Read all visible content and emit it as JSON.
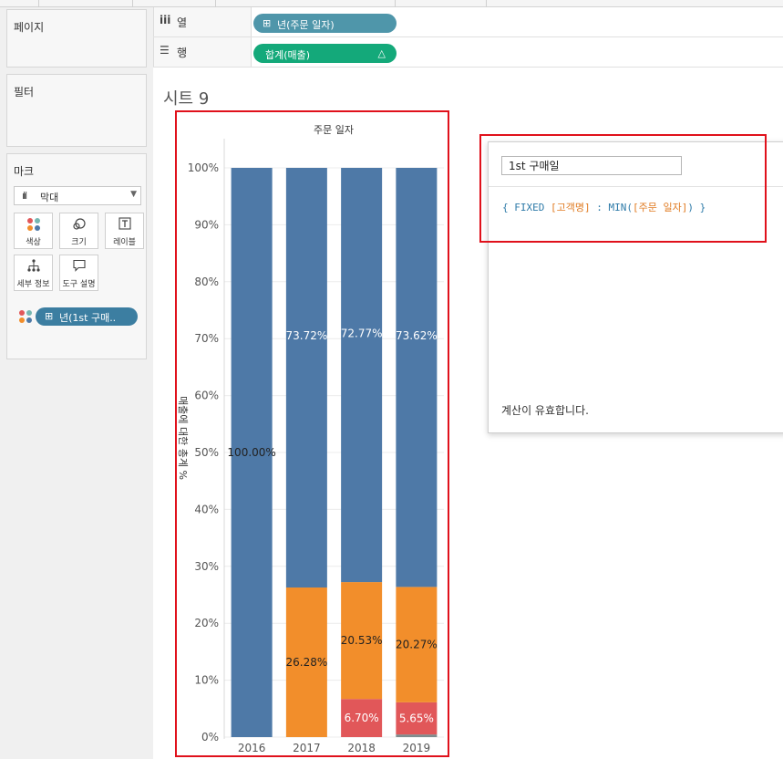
{
  "shelves": {
    "columns": {
      "label": "열",
      "icon": "iii",
      "pill_label": "년(주문 일자)",
      "pill_icon": "⊞",
      "pill_color": "#4f96aa"
    },
    "rows": {
      "label": "행",
      "icon": "☰",
      "pill_label": "합계(매출)",
      "pill_delta": "△",
      "pill_color": "#14a97a"
    }
  },
  "cards": {
    "pages": {
      "title": "페이지"
    },
    "filters": {
      "title": "필터"
    },
    "marks": {
      "title": "마크",
      "mark_type": "막대",
      "buttons": {
        "color": "색상",
        "size": "크기",
        "label": "레이블",
        "detail": "세부 정보",
        "tooltip": "도구 설명"
      },
      "color_pill": "년(1st 구매..",
      "color_pill_icon": "⊞"
    }
  },
  "sheet": {
    "title": "시트 9"
  },
  "chart_data": {
    "type": "bar",
    "stacked": true,
    "header": "주문 일자",
    "categories": [
      "2016",
      "2017",
      "2018",
      "2019"
    ],
    "ylabel": "매출에 대한 총계 %",
    "ylim": [
      0,
      100
    ],
    "yticks": [
      "0%",
      "10%",
      "20%",
      "30%",
      "40%",
      "50%",
      "60%",
      "70%",
      "80%",
      "90%",
      "100%"
    ],
    "series": [
      {
        "color": "#7f8c8d",
        "values": [
          0,
          0,
          0,
          0.46
        ],
        "labels": [
          "",
          "",
          "",
          ""
        ]
      },
      {
        "color": "#e15759",
        "values": [
          0,
          0,
          6.7,
          5.65
        ],
        "labels": [
          "",
          "",
          "6.70%",
          "5.65%"
        ]
      },
      {
        "color": "#f28e2b",
        "values": [
          0,
          26.28,
          20.53,
          20.27
        ],
        "labels": [
          "",
          "26.28%",
          "20.53%",
          "20.27%"
        ]
      },
      {
        "color": "#4e79a7",
        "values": [
          100.0,
          73.72,
          72.77,
          73.62
        ],
        "labels": [
          "100.00%",
          "73.72%",
          "72.77%",
          "73.62%"
        ]
      }
    ],
    "grid": true,
    "legend": "none"
  },
  "calc": {
    "name": "1st 구매일",
    "formula": {
      "open": "{",
      "keyword": "FIXED",
      "field1": "[고객명]",
      "colon": ":",
      "func": "MIN(",
      "field2": "[주문 일자]",
      "close_paren": ")",
      "close": "}"
    },
    "status": "계산이 유효합니다."
  },
  "colors": {
    "highlight": "#e0111b"
  }
}
